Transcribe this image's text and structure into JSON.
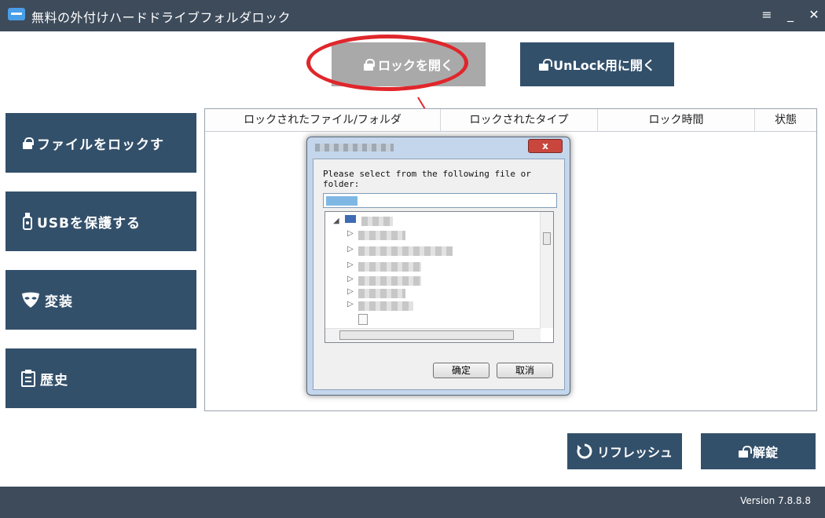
{
  "window": {
    "title": "無料の外付けハードドライブフォルダロック",
    "controls": {
      "menu": "≡",
      "minimize": "_",
      "close": "✕"
    }
  },
  "toolbar": {
    "open_lock_label": "ロックを開く",
    "open_unlock_label": "UnLock用に開く"
  },
  "sidebar": {
    "items": [
      {
        "label": "ファイルをロックす",
        "icon": "lock-icon"
      },
      {
        "label": "USBを保護する",
        "icon": "usb-icon"
      },
      {
        "label": "変装",
        "icon": "mask-icon"
      },
      {
        "label": "歴史",
        "icon": "clipboard-icon"
      }
    ]
  },
  "table": {
    "headers": [
      "ロックされたファイル/フォルダ",
      "ロックされたタイプ",
      "ロック時間",
      "状態"
    ]
  },
  "dialog": {
    "message": "Please select from the following file or folder:",
    "ok_label": "确定",
    "cancel_label": "取消",
    "close_glyph": "x"
  },
  "actions": {
    "refresh_label": "リフレッシュ",
    "unlock_label": "解錠"
  },
  "footer": {
    "version": "Version 7.8.8.8"
  },
  "colors": {
    "titlebar": "#3d4b5b",
    "primary_button": "#33506b",
    "disabled_button": "#a9a9a9",
    "annotation_red": "#e0262b"
  }
}
